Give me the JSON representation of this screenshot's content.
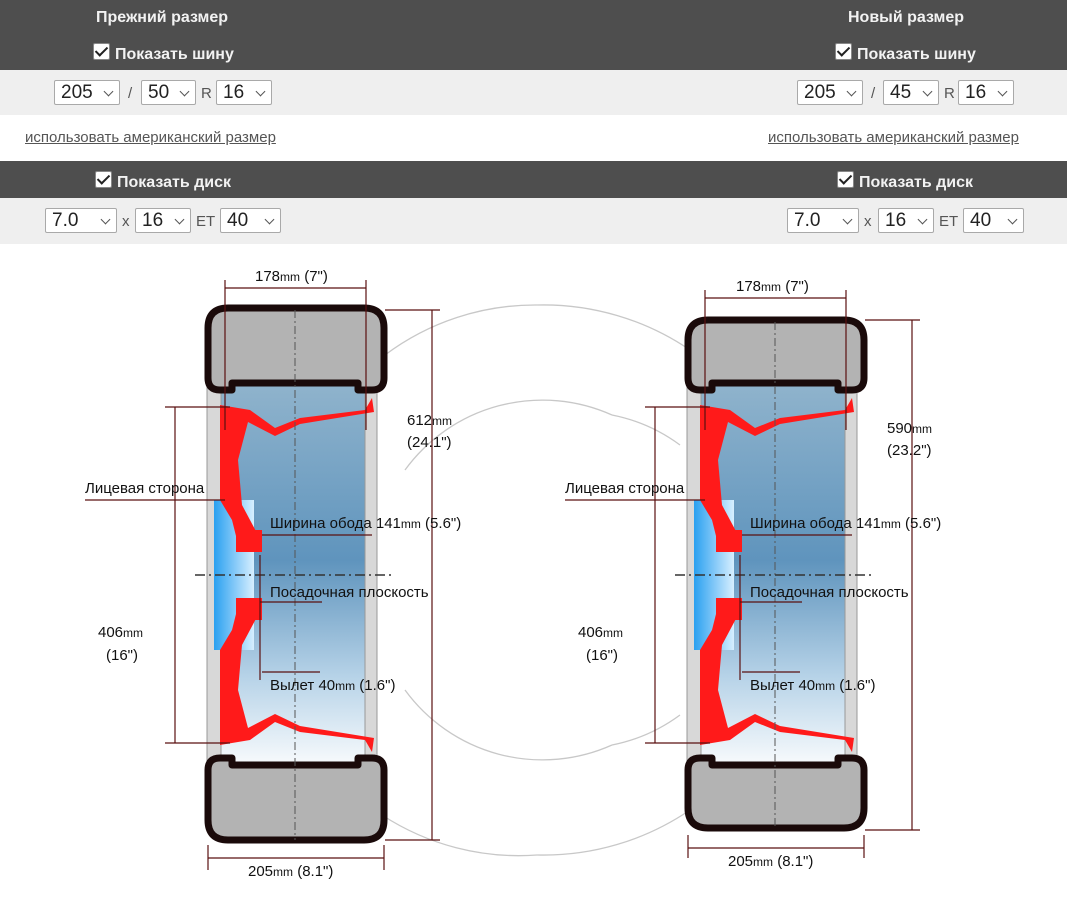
{
  "old": {
    "header": "Прежний размер",
    "show_tire": "Показать шину",
    "tire": {
      "width": "205",
      "profile": "50",
      "r_label": "R",
      "radius": "16"
    },
    "american_link": "использовать американский размер",
    "show_disk": "Показать диск",
    "disk": {
      "width": "7.0",
      "x_label": "x",
      "diameter": "16",
      "et_label": "ET",
      "et": "40"
    }
  },
  "new": {
    "header": "Новый размер",
    "show_tire": "Показать шину",
    "tire": {
      "width": "205",
      "profile": "45",
      "r_label": "R",
      "radius": "16"
    },
    "american_link": "использовать американский размер",
    "show_disk": "Показать диск",
    "disk": {
      "width": "7.0",
      "x_label": "x",
      "diameter": "16",
      "et_label": "ET",
      "et": "40"
    }
  },
  "separators": {
    "slash": "/"
  },
  "diagram_labels": {
    "face_side": "Лицевая сторона",
    "rim_width": "Ширина обода",
    "mounting_plane": "Посадочная плоскость",
    "offset": "Вылет"
  },
  "old_diagram": {
    "disk_width_val": "178",
    "disk_width_unit": "mm",
    "disk_width_in": " (7\")",
    "outer_diameter_val": "612",
    "outer_diameter_unit": "mm",
    "outer_diameter_in": "(24.1\")",
    "rim_width_val": "141",
    "rim_width_unit": "mm",
    "rim_width_in": " (5.6\")",
    "offset_val": "40",
    "offset_unit": "mm",
    "offset_in": " (1.6\")",
    "rim_diameter_val": "406",
    "rim_diameter_unit": "mm",
    "rim_diameter_in": "(16\")",
    "tire_width_val": "205",
    "tire_width_unit": "mm",
    "tire_width_in": " (8.1\")"
  },
  "new_diagram": {
    "disk_width_val": "178",
    "disk_width_unit": "mm",
    "disk_width_in": " (7\")",
    "outer_diameter_val": "590",
    "outer_diameter_unit": "mm",
    "outer_diameter_in": "(23.2\")",
    "rim_width_val": "141",
    "rim_width_unit": "mm",
    "rim_width_in": " (5.6\")",
    "offset_val": "40",
    "offset_unit": "mm",
    "offset_in": " (1.6\")",
    "rim_diameter_val": "406",
    "rim_diameter_unit": "mm",
    "rim_diameter_in": "(16\")",
    "tire_width_val": "205",
    "tire_width_unit": "mm",
    "tire_width_in": " (8.1\")"
  },
  "colors": {
    "header_bg": "#4e4e4e",
    "row_bg": "#efefef",
    "disk_red": "#ff1a1a",
    "tire_black": "#1a0a0a"
  }
}
